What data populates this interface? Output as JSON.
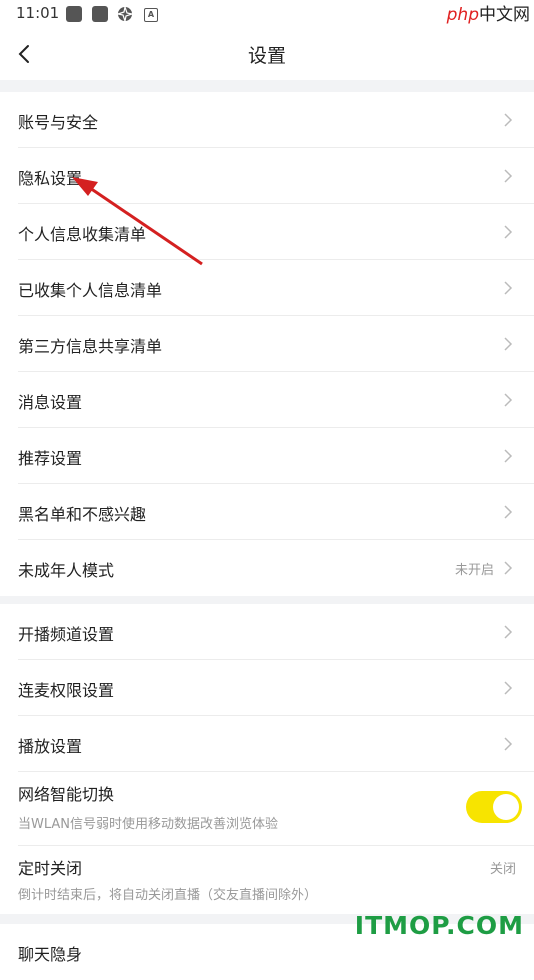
{
  "status_bar": {
    "time": "11:01"
  },
  "watermark_top": {
    "php": "php",
    "cn": "中文网"
  },
  "header": {
    "title": "设置"
  },
  "group1": [
    {
      "label": "账号与安全"
    },
    {
      "label": "隐私设置"
    },
    {
      "label": "个人信息收集清单"
    },
    {
      "label": "已收集个人信息清单"
    },
    {
      "label": "第三方信息共享清单"
    },
    {
      "label": "消息设置"
    },
    {
      "label": "推荐设置"
    },
    {
      "label": "黑名单和不感兴趣"
    },
    {
      "label": "未成年人模式",
      "value": "未开启"
    }
  ],
  "group2": [
    {
      "label": "开播频道设置"
    },
    {
      "label": "连麦权限设置"
    },
    {
      "label": "播放设置"
    }
  ],
  "network_switch": {
    "label": "网络智能切换",
    "description": "当WLAN信号弱时使用移动数据改善浏览体验",
    "enabled": true
  },
  "timer_off": {
    "label": "定时关闭",
    "description": "倒计时结束后，将自动关闭直播（交友直播间除外）",
    "value": "关闭"
  },
  "group3": [
    {
      "label": "聊天隐身"
    }
  ],
  "colors": {
    "accent_toggle": "#f7e400",
    "annotation_arrow": "#d42020",
    "watermark": "#1e9d44"
  },
  "watermark_bottom": "ITMOP.COM"
}
